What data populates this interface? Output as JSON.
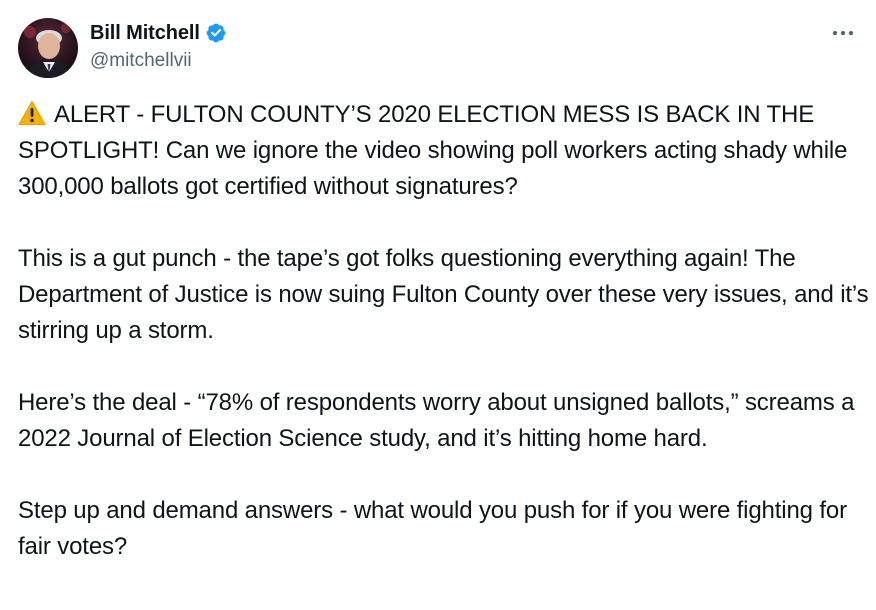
{
  "author": {
    "name": "Bill Mitchell",
    "handle": "@mitchellvii",
    "verified_color": "#1d9bf0"
  },
  "menu": {
    "icon": "more-dots-icon"
  },
  "tweet": {
    "lead_icon": "warning-icon",
    "paragraphs": [
      "ALERT - FULTON COUNTY’S 2020 ELECTION MESS IS BACK IN THE SPOTLIGHT!  Can we ignore the video showing poll workers acting shady while 300,000 ballots got certified without signatures?",
      "This is a gut punch - the tape’s got folks questioning everything again! The Department of Justice is now suing Fulton County over these very issues, and it’s stirring up a storm.",
      "Here’s the deal - “78% of respondents worry about unsigned ballots,” screams a 2022 Journal of Election Science study, and it’s hitting home hard.",
      "Step up and demand answers - what would you push for if you were fighting for fair votes?"
    ]
  },
  "colors": {
    "text": "#0f1419",
    "secondary": "#536471",
    "warning": "#f5b301"
  }
}
